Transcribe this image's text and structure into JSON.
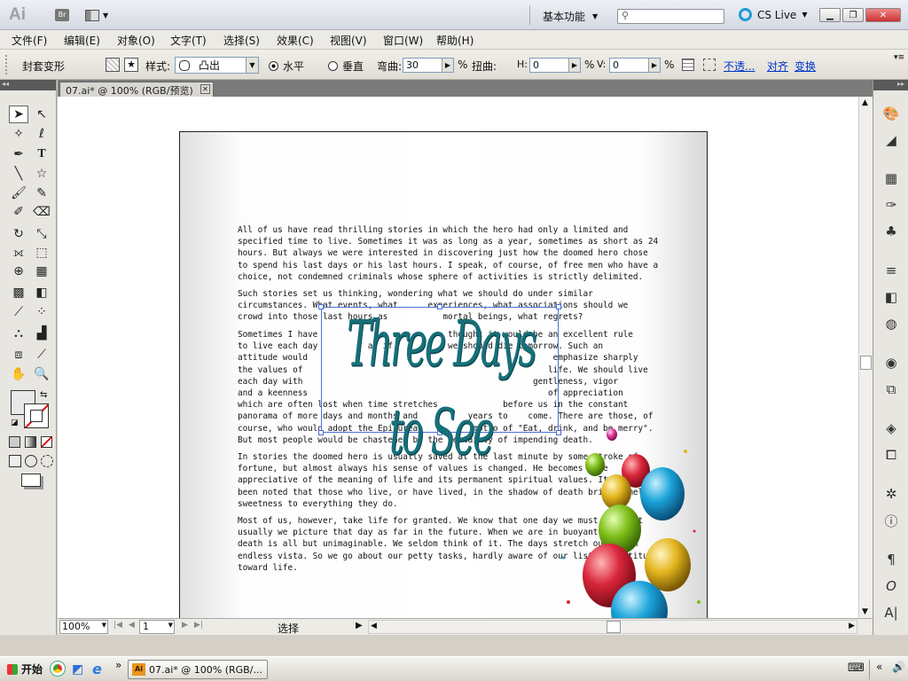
{
  "app": {
    "logo": "Ai",
    "bridge_label": "Br",
    "workspace": "基本功能",
    "cslive": "CS Live",
    "search_placeholder": ""
  },
  "menu": [
    "文件(F)",
    "编辑(E)",
    "对象(O)",
    "文字(T)",
    "选择(S)",
    "效果(C)",
    "视图(V)",
    "窗口(W)",
    "帮助(H)"
  ],
  "control": {
    "envelope": "封套变形",
    "style_label": "样式:",
    "style_value": "凸出",
    "horizontal": "水平",
    "vertical": "垂直",
    "bend_label": "弯曲:",
    "bend_value": "30",
    "bend_unit": "%",
    "distort_label": "扭曲:",
    "h_label": "H:",
    "h_value": "0",
    "h_unit": "%",
    "v_label": "V:",
    "v_value": "0",
    "v_unit": "%",
    "opacity_link": "不透...",
    "align_link": "对齐",
    "transform_link": "变换"
  },
  "document": {
    "tab_title": "07.ai* @ 100% (RGB/预览)",
    "paragraphs": [
      "All of us have read thrilling stories in which the hero had only a limited and\nspecified time to live. Sometimes it was as long as a year, sometimes as short as 24\nhours. But always we were interested in discovering just how the doomed hero chose\nto spend his last days or his last hours. I speak, of course, of free men who have a\nchoice, not condemned criminals whose sphere of activities is strictly delimited.",
      "Such stories set us thinking, wondering what we should do under similar\ncircumstances. What events, what      experiences, what associations should we\ncrowd into those last hours as           mortal beings, what regrets?",
      "Sometimes I have                          thought it would be an excellent rule\nto live each day          as if           we should die tomorrow. Such an\nattitude would                                                 emphasize sharply\nthe values of                                                 life. We should live\neach day with                                              gentleness, vigor\nand a keenness                                                of appreciation\nwhich are often lost when time stretches             before us in the constant\npanorama of more days and months and          years to    come. There are those, of\ncourse, who would adopt the Epicurean          motto of \"Eat, drink, and be merry\".\nBut most people would be chastened by the certainty of impending death.",
      "In stories the doomed hero is usually saved at the last minute by some stroke of\nfortune, but almost always his sense of values is changed. He becomes more\nappreciative of the meaning of life and its permanent spiritual values. It has often\nbeen noted that those who live, or have lived, in the shadow of death bring a mellow\nsweetness to everything they do.",
      "Most of us, however, take life for granted. We know that one day we must die, but\nusually we picture that day as far in the future. When we are in buoyant health,\ndeath is all but unimaginable. We seldom think of it. The days stretch out in an\nendless vista. So we go about our petty tasks, hardly aware of our listless attitude\ntoward life."
    ],
    "warped_title": "Three Days to See"
  },
  "status": {
    "zoom": "100%",
    "page": "1",
    "tool_label": "选择"
  },
  "taskbar": {
    "start": "开始",
    "task": "07.ai* @ 100% (RGB/..."
  }
}
